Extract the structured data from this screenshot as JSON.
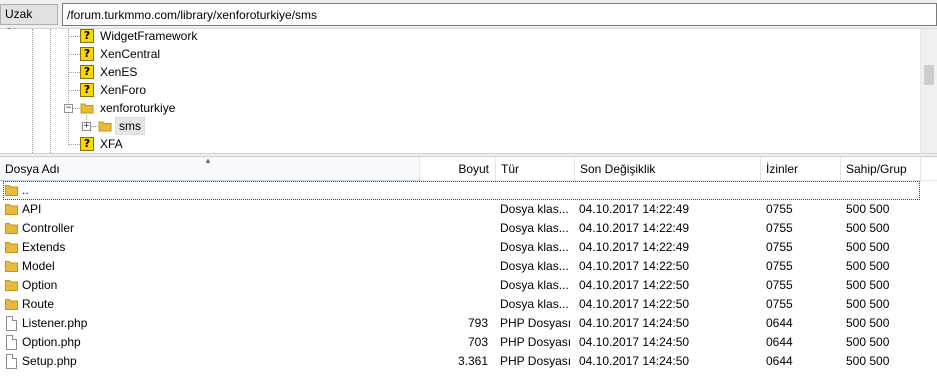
{
  "address": {
    "label": "Uzak Site:",
    "path": "/forum.turkmmo.com/library/xenforoturkiye/sms"
  },
  "tree": {
    "items": [
      {
        "label": "WidgetFramework",
        "icon": "question-icon"
      },
      {
        "label": "XenCentral",
        "icon": "question-icon"
      },
      {
        "label": "XenES",
        "icon": "question-icon"
      },
      {
        "label": "XenForo",
        "icon": "question-icon"
      },
      {
        "label": "xenforoturkiye",
        "icon": "folder-icon",
        "expander": "−"
      },
      {
        "label": "sms",
        "icon": "folder-icon",
        "expander": "+",
        "selected": true
      },
      {
        "label": "XFA",
        "icon": "question-icon"
      }
    ]
  },
  "list": {
    "columns": {
      "name": "Dosya Adı",
      "size": "Boyut",
      "type": "Tür",
      "modified": "Son Değişiklik",
      "perms": "İzinler",
      "owner": "Sahip/Grup"
    },
    "sort_indicator": "▲",
    "rows": [
      {
        "name": "..",
        "size": "",
        "type": "",
        "modified": "",
        "perms": "",
        "owner": "",
        "icon": "folder-icon"
      },
      {
        "name": "API",
        "size": "",
        "type": "Dosya klas...",
        "modified": "04.10.2017 14:22:49",
        "perms": "0755",
        "owner": "500 500",
        "icon": "folder-icon"
      },
      {
        "name": "Controller",
        "size": "",
        "type": "Dosya klas...",
        "modified": "04.10.2017 14:22:49",
        "perms": "0755",
        "owner": "500 500",
        "icon": "folder-icon"
      },
      {
        "name": "Extends",
        "size": "",
        "type": "Dosya klas...",
        "modified": "04.10.2017 14:22:49",
        "perms": "0755",
        "owner": "500 500",
        "icon": "folder-icon"
      },
      {
        "name": "Model",
        "size": "",
        "type": "Dosya klas...",
        "modified": "04.10.2017 14:22:50",
        "perms": "0755",
        "owner": "500 500",
        "icon": "folder-icon"
      },
      {
        "name": "Option",
        "size": "",
        "type": "Dosya klas...",
        "modified": "04.10.2017 14:22:50",
        "perms": "0755",
        "owner": "500 500",
        "icon": "folder-icon"
      },
      {
        "name": "Route",
        "size": "",
        "type": "Dosya klas...",
        "modified": "04.10.2017 14:22:50",
        "perms": "0755",
        "owner": "500 500",
        "icon": "folder-icon"
      },
      {
        "name": "Listener.php",
        "size": "793",
        "type": "PHP Dosyası",
        "modified": "04.10.2017 14:24:50",
        "perms": "0644",
        "owner": "500 500",
        "icon": "file-icon"
      },
      {
        "name": "Option.php",
        "size": "703",
        "type": "PHP Dosyası",
        "modified": "04.10.2017 14:24:50",
        "perms": "0644",
        "owner": "500 500",
        "icon": "file-icon"
      },
      {
        "name": "Setup.php",
        "size": "3.361",
        "type": "PHP Dosyası",
        "modified": "04.10.2017 14:24:50",
        "perms": "0644",
        "owner": "500 500",
        "icon": "file-icon"
      }
    ]
  },
  "colors": {
    "folder": "#e8b93a",
    "folder_dark": "#c99419",
    "question_bg": "#ffd700"
  }
}
